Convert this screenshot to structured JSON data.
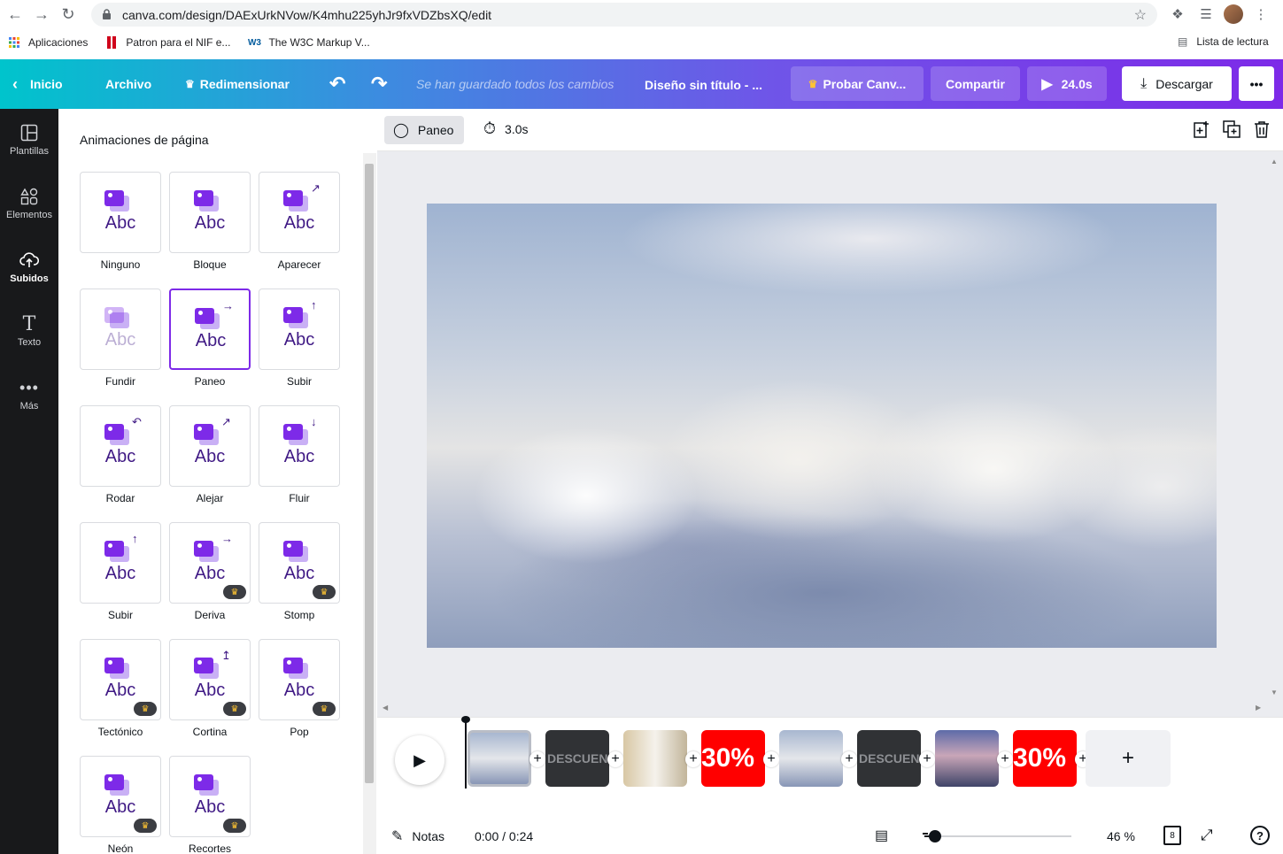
{
  "browser": {
    "url": "canva.com/design/DAExUrkNVow/K4mhu225yhJr9fxVDZbsXQ/edit",
    "bookmarks": [
      {
        "label": "Aplicaciones",
        "icon": "apps-grid-icon"
      },
      {
        "label": "Patron para el NIF e...",
        "icon": "bookmark-red-icon"
      },
      {
        "label": "The W3C Markup V...",
        "icon": "w3c-icon"
      }
    ],
    "reading_list": "Lista de lectura"
  },
  "topbar": {
    "home": "Inicio",
    "file": "Archivo",
    "resize": "Redimensionar",
    "saved_status": "Se han guardado todos los cambios",
    "doc_title": "Diseño sin título - ...",
    "try_pro": "Probar Canv...",
    "share": "Compartir",
    "duration": "24.0s",
    "download": "Descargar",
    "more": "•••"
  },
  "leftnav": [
    {
      "label": "Plantillas",
      "icon": "templates-icon",
      "active": false
    },
    {
      "label": "Elementos",
      "icon": "elements-icon",
      "active": false
    },
    {
      "label": "Subidos",
      "icon": "upload-cloud-icon",
      "active": true
    },
    {
      "label": "Texto",
      "icon": "text-icon",
      "active": false
    },
    {
      "label": "Más",
      "icon": "more-dots-icon",
      "active": false
    }
  ],
  "panel": {
    "title": "Animaciones de página",
    "tile_text": "Abc",
    "animations": [
      {
        "label": "Ninguno",
        "pro": false,
        "selected": false
      },
      {
        "label": "Bloque",
        "pro": false,
        "selected": false
      },
      {
        "label": "Aparecer",
        "pro": false,
        "selected": false
      },
      {
        "label": "Fundir",
        "pro": false,
        "selected": false
      },
      {
        "label": "Paneo",
        "pro": false,
        "selected": true
      },
      {
        "label": "Subir",
        "pro": false,
        "selected": false
      },
      {
        "label": "Rodar",
        "pro": false,
        "selected": false
      },
      {
        "label": "Alejar",
        "pro": false,
        "selected": false
      },
      {
        "label": "Fluir",
        "pro": false,
        "selected": false
      },
      {
        "label": "Subir",
        "pro": false,
        "selected": false
      },
      {
        "label": "Deriva",
        "pro": true,
        "selected": false
      },
      {
        "label": "Stomp",
        "pro": true,
        "selected": false
      },
      {
        "label": "Tectónico",
        "pro": true,
        "selected": false
      },
      {
        "label": "Cortina",
        "pro": true,
        "selected": false
      },
      {
        "label": "Pop",
        "pro": true,
        "selected": false
      },
      {
        "label": "Neón",
        "pro": true,
        "selected": false
      },
      {
        "label": "Recortes",
        "pro": true,
        "selected": false
      }
    ]
  },
  "editor": {
    "animation_label": "Paneo",
    "timer_value": "3.0s"
  },
  "timeline": {
    "clips": [
      {
        "kind": "sky",
        "text": "",
        "active": true
      },
      {
        "kind": "dark",
        "text": "DESCUEN",
        "active": false
      },
      {
        "kind": "room",
        "text": "",
        "active": false
      },
      {
        "kind": "red",
        "text": "30%",
        "active": false
      },
      {
        "kind": "sky",
        "text": "",
        "active": false
      },
      {
        "kind": "dark",
        "text": "DESCUEN",
        "active": false
      },
      {
        "kind": "house",
        "text": "",
        "active": false
      },
      {
        "kind": "red",
        "text": "30%",
        "active": false
      }
    ],
    "add_page": "+"
  },
  "footer": {
    "notes": "Notas",
    "time": "0:00 / 0:24",
    "zoom_percent": "46 %",
    "zoom_level": 0.07,
    "pages_count": "8",
    "help": "?"
  }
}
